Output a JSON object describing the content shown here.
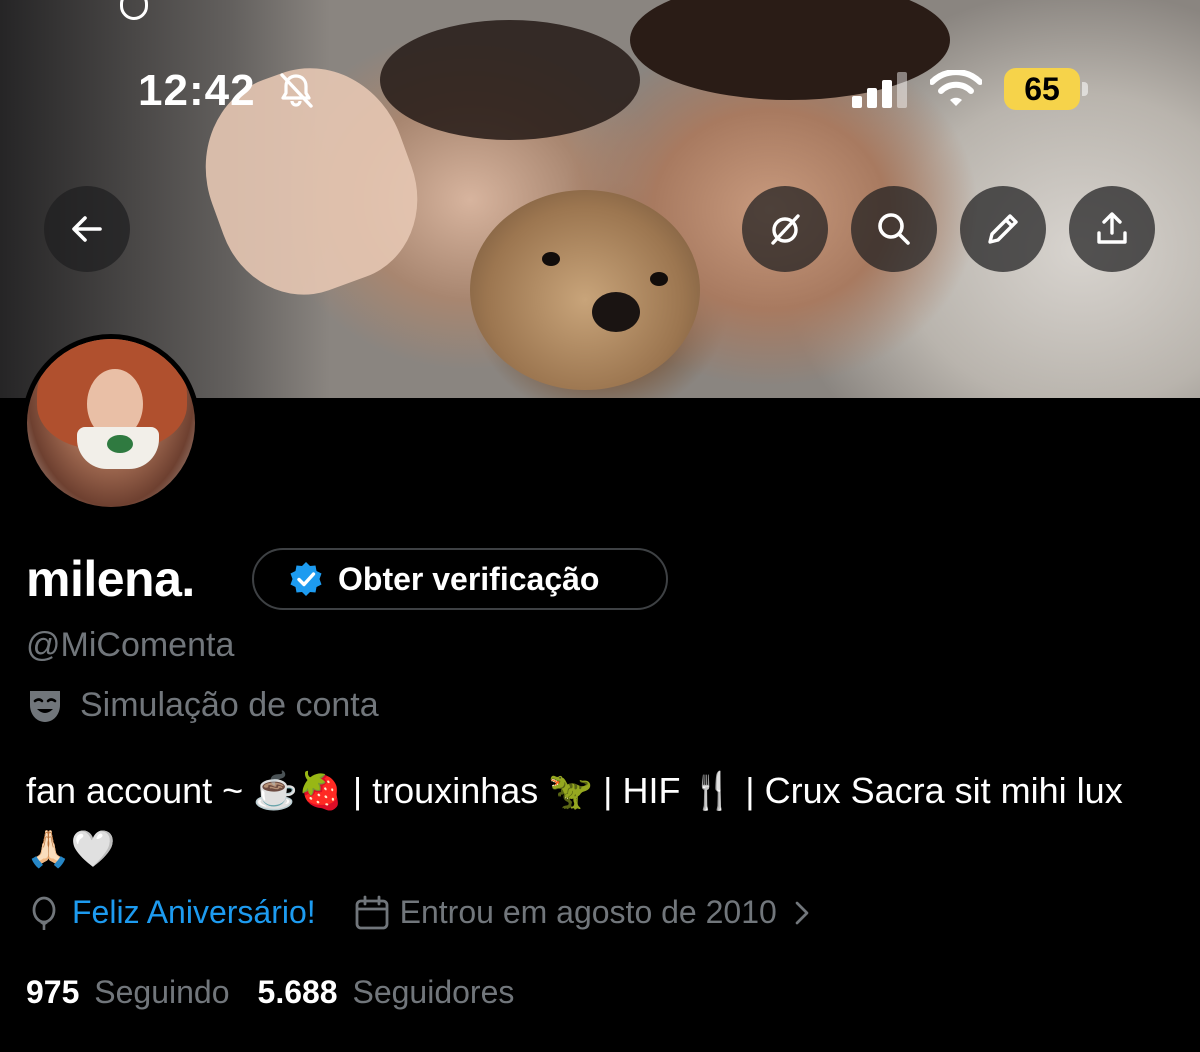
{
  "status_bar": {
    "time": "12:42",
    "battery": "65",
    "icons": [
      "bell-slash-icon",
      "cellular-signal-icon",
      "wifi-icon",
      "battery-icon"
    ]
  },
  "header": {
    "buttons": [
      "back-icon",
      "grok-icon",
      "search-icon",
      "edit-icon",
      "share-icon"
    ]
  },
  "profile": {
    "display_name": "milena.",
    "verify_label": "Obter verificação",
    "handle": "@MiComenta",
    "parody_label": "Simulação de conta",
    "bio": "fan account ~ ☕🍓 | trouxinhas 🦖 | HIF 🍴 | Crux Sacra sit mihi lux 🙏🏻🤍",
    "birthday": "Feliz Aniversário!",
    "joined": "Entrou em agosto de 2010",
    "following_count": "975",
    "following_label": "Seguindo",
    "followers_count": "5.688",
    "followers_label": "Seguidores"
  },
  "colors": {
    "background": "#000000",
    "accent": "#1d9bf0",
    "muted": "#71767b",
    "battery": "#f6d34a"
  }
}
